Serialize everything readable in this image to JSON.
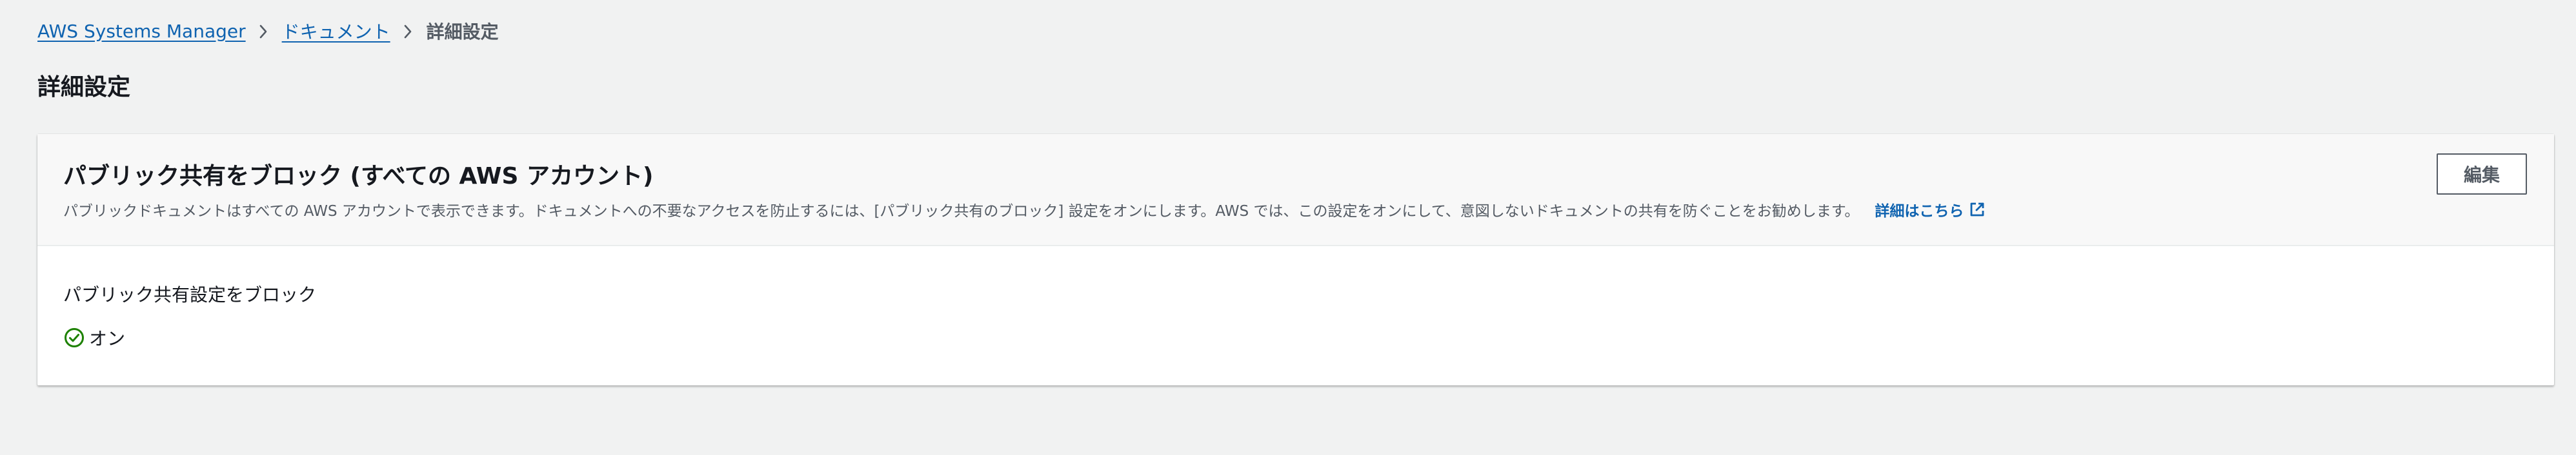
{
  "breadcrumb": {
    "items": [
      {
        "label": "AWS Systems Manager"
      },
      {
        "label": "ドキュメント"
      },
      {
        "label": "詳細設定"
      }
    ]
  },
  "page": {
    "title": "詳細設定"
  },
  "panel": {
    "title": "パブリック共有をブロック (すべての AWS アカウント)",
    "description": "パブリックドキュメントはすべての AWS アカウントで表示できます。ドキュメントへの不要なアクセスを防止するには、[パブリック共有のブロック] 設定をオンにします。AWS では、この設定をオンにして、意図しないドキュメントの共有を防ぐことをお勧めします。",
    "learn_more_label": "詳細はこちら",
    "edit_label": "編集"
  },
  "setting": {
    "label": "パブリック共有設定をブロック",
    "value": "オン",
    "status_icon": "check-circle-icon"
  },
  "colors": {
    "link": "#0f63b0",
    "status_ok": "#1d8102",
    "background": "#f1f2f2"
  }
}
